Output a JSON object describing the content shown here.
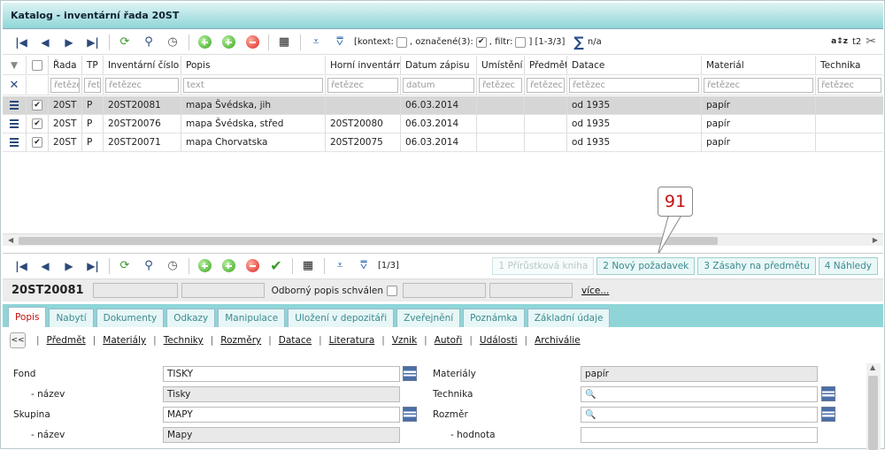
{
  "window": {
    "title": "Katalog - inventární řada 20ST"
  },
  "toolbar1": {
    "context_label": "[kontext:",
    "marked_label": ", označené(3):",
    "filter_label": ", filtr:",
    "range": "] [1-3/3]",
    "sum_value": "n/a",
    "right_label": "t2",
    "marked_checked": true
  },
  "grid": {
    "columns": [
      "",
      "",
      "Řada",
      "TP",
      "Inventární číslo",
      "Popis",
      "Horní inventární",
      "Datum zápisu",
      "Umístění",
      "Předmět",
      "Datace",
      "Materiál",
      "Technika"
    ],
    "filters": [
      "",
      "",
      "řetězec",
      "řet",
      "řetězec",
      "text",
      "řetězec",
      "datum",
      "řetězec",
      "řetězec",
      "řetězec",
      "řetězec",
      "řetězec"
    ],
    "rows": [
      {
        "selected": true,
        "cells": [
          "20ST",
          "P",
          "20ST20081",
          "mapa Švédska, jih",
          "",
          "06.03.2014",
          "",
          "",
          "od 1935",
          "papír",
          ""
        ]
      },
      {
        "selected": false,
        "cells": [
          "20ST",
          "P",
          "20ST20076",
          "mapa Švédska, střed",
          "20ST20080",
          "06.03.2014",
          "",
          "",
          "od 1935",
          "papír",
          ""
        ]
      },
      {
        "selected": false,
        "cells": [
          "20ST",
          "P",
          "20ST20071",
          "mapa Chorvatska",
          "20ST20075",
          "06.03.2014",
          "",
          "",
          "od 1935",
          "papír",
          ""
        ]
      }
    ]
  },
  "callout": {
    "number": "91"
  },
  "toolbar2": {
    "range": "[1/3]",
    "tabs": [
      {
        "label": "1 Přírůstková kniha",
        "disabled": true
      },
      {
        "label": "2 Nový požadavek",
        "disabled": false
      },
      {
        "label": "3 Zásahy na předmětu",
        "disabled": false
      },
      {
        "label": "4 Náhledy",
        "disabled": false
      }
    ]
  },
  "info": {
    "inventory": "20ST20081",
    "approved_label": "Odborný popis schválen",
    "more_link": "více..."
  },
  "tabs": [
    "Popis",
    "Nabytí",
    "Dokumenty",
    "Odkazy",
    "Manipulace",
    "Uložení v depozitáři",
    "Zveřejnění",
    "Poznámka",
    "Základní údaje"
  ],
  "subnav": {
    "back": "<<",
    "links": [
      "Předmět",
      "Materiály",
      "Techniky",
      "Rozměry",
      "Datace",
      "Literatura",
      "Vznik",
      "Autoři",
      "Události",
      "Archiválie"
    ]
  },
  "form": {
    "left": [
      {
        "label": "Fond",
        "value": "TISKY"
      },
      {
        "label": "- název",
        "value": "Tisky"
      },
      {
        "label": "Skupina",
        "value": "MAPY"
      },
      {
        "label": "- název",
        "value": "Mapy"
      }
    ],
    "right": [
      {
        "label": "Materiály",
        "value": "papír"
      },
      {
        "label": "Technika",
        "value": ""
      },
      {
        "label": "Rozměr",
        "value": ""
      },
      {
        "label": "- hodnota",
        "value": ""
      }
    ]
  }
}
